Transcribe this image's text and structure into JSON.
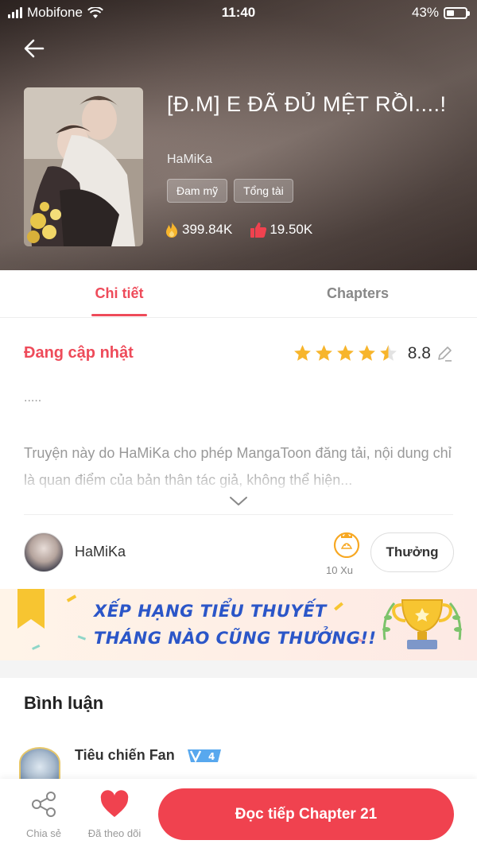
{
  "status_bar": {
    "carrier": "Mobifone",
    "time": "11:40",
    "battery": "43%",
    "battery_level": 0.43
  },
  "book": {
    "title": "[Đ.M] E ĐÃ ĐỦ MỆT RỒI....!",
    "author": "HaMiKa",
    "tags": [
      "Đam mỹ",
      "Tổng tài"
    ],
    "views": "399.84K",
    "likes": "19.50K"
  },
  "tabs": {
    "details": "Chi tiết",
    "chapters": "Chapters"
  },
  "details": {
    "status": "Đang cập nhật",
    "rating_value": "8.8",
    "stars": 4.5,
    "intro": ".....",
    "description": "Truyện này do HaMiKa cho phép MangaToon đăng tải, nội dung chỉ là quan điểm của bản thân tác giả, không thể hiện..."
  },
  "author_row": {
    "name": "HaMiKa",
    "coins": "10 Xu",
    "reward_button": "Thưởng"
  },
  "banner": {
    "line1": "XẾP HẠNG TIỂU THUYẾT",
    "line2": "THÁNG NÀO CŨNG THƯỞNG!!"
  },
  "comments": {
    "title": "Bình luận",
    "first_user": "Tiêu chiến Fan",
    "first_user_level": "4"
  },
  "bottom_bar": {
    "share_label": "Chia sẻ",
    "follow_label": "Đã theo dõi",
    "read_button": "Đọc tiếp Chapter 21"
  },
  "colors": {
    "accent": "#ee4b5a",
    "star": "#f7b52c",
    "banner_text": "#2b56c8"
  }
}
